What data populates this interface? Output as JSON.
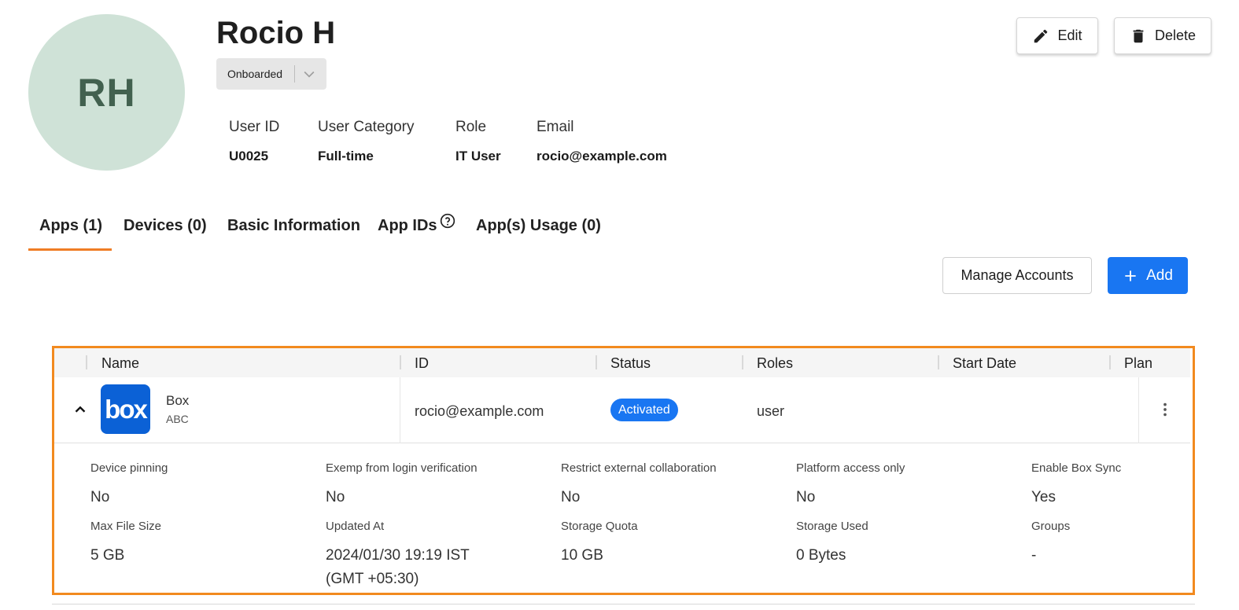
{
  "user": {
    "initials": "RH",
    "name": "Rocio H",
    "status": "Onboarded",
    "fields": [
      {
        "label": "User ID",
        "value": "U0025"
      },
      {
        "label": "User Category",
        "value": "Full-time"
      },
      {
        "label": "Role",
        "value": "IT User"
      },
      {
        "label": "Email",
        "value": "rocio@example.com"
      }
    ]
  },
  "actions": {
    "edit_label": "Edit",
    "delete_label": "Delete"
  },
  "tabs": [
    {
      "label": "Apps (1)",
      "active": true
    },
    {
      "label": "Devices (0)"
    },
    {
      "label": "Basic Information"
    },
    {
      "label": "App IDs"
    },
    {
      "label": "App(s) Usage (0)"
    }
  ],
  "toolbar": {
    "manage_label": "Manage Accounts",
    "add_label": "Add"
  },
  "colors": {
    "accent": "#ef7d25",
    "primary": "#1976f2",
    "avatar_bg": "#cfe2d7",
    "box_brand": "#0b61d6"
  },
  "table": {
    "columns": [
      "Name",
      "ID",
      "Status",
      "Roles",
      "Start Date",
      "Plan"
    ],
    "row": {
      "app_logo_text": "box",
      "app_name": "Box",
      "app_sub": "ABC",
      "id": "rocio@example.com",
      "status": "Activated",
      "roles": "user",
      "start_date": "",
      "plan": ""
    },
    "details": [
      {
        "label": "Device pinning",
        "value": "No"
      },
      {
        "label": "Exemp from login verification",
        "value": "No"
      },
      {
        "label": "Restrict external collaboration",
        "value": "No"
      },
      {
        "label": "Platform access only",
        "value": "No"
      },
      {
        "label": "Enable Box Sync",
        "value": "Yes"
      },
      {
        "label": "Max File Size",
        "value": "5 GB"
      },
      {
        "label": "Updated At",
        "value": "2024/01/30 19:19 IST (GMT +05:30)"
      },
      {
        "label": "Storage Quota",
        "value": "10 GB"
      },
      {
        "label": "Storage Used",
        "value": "0 Bytes"
      },
      {
        "label": "Groups",
        "value": "-"
      }
    ]
  },
  "icons": [
    "pencil-icon",
    "trash-icon",
    "chevron-down-icon",
    "help-circle-icon",
    "plus-icon",
    "chevron-up-icon",
    "more-vertical-icon"
  ]
}
